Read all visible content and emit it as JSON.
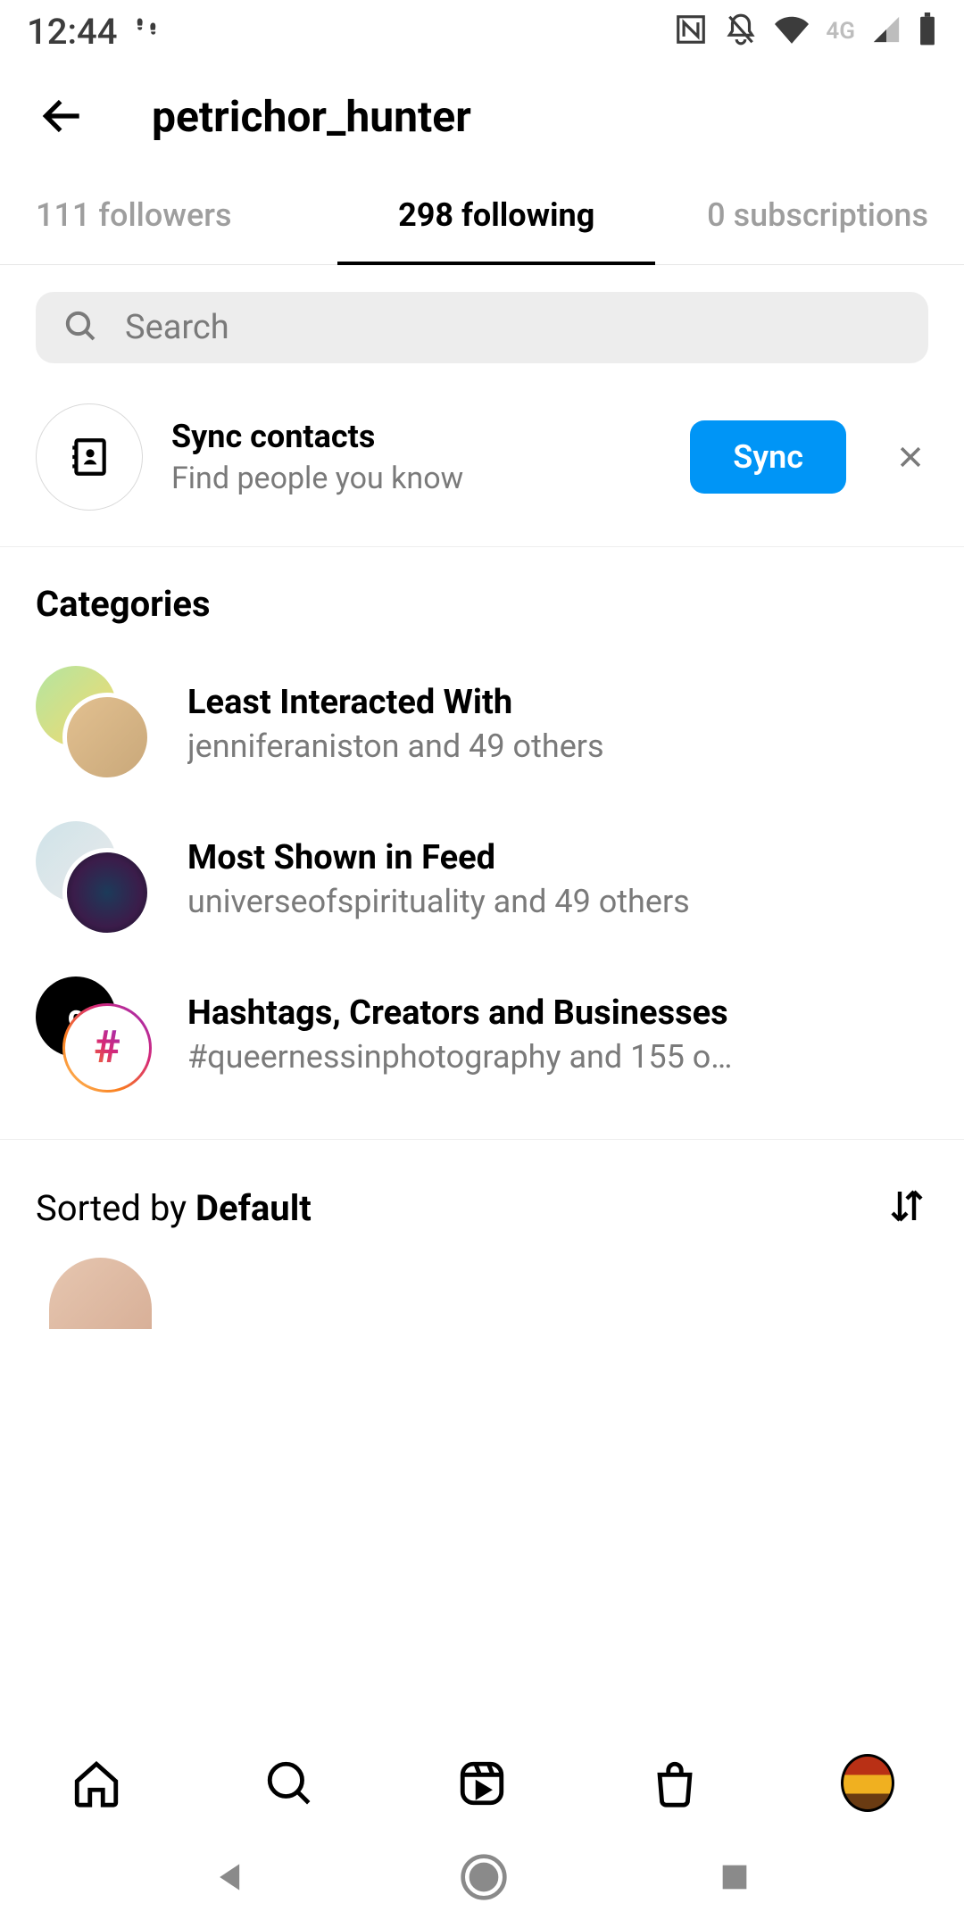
{
  "status": {
    "time": "12:44"
  },
  "header": {
    "title": "petrichor_hunter"
  },
  "tabs": {
    "followers": "111 followers",
    "following": "298 following",
    "subscriptions": "0 subscriptions"
  },
  "search": {
    "placeholder": "Search"
  },
  "sync": {
    "title": "Sync contacts",
    "sub": "Find people you know",
    "button": "Sync"
  },
  "categories": {
    "heading": "Categories",
    "items": [
      {
        "title": "Least Interacted With",
        "sub": "jenniferaniston and 49 others"
      },
      {
        "title": "Most Shown in Feed",
        "sub": "universeofspirituality and 49 others"
      },
      {
        "title": "Hashtags, Creators and Businesses",
        "sub": "#queernessinphotography and 155 o…"
      }
    ]
  },
  "sorted": {
    "prefix": "Sorted by ",
    "value": "Default"
  }
}
